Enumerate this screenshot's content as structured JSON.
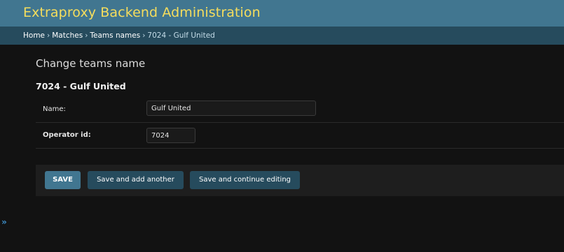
{
  "header": {
    "site_title": "Extraproxy Backend Administration"
  },
  "breadcrumbs": {
    "items": [
      "Home",
      "Matches",
      "Teams names",
      "7024 - Gulf United"
    ],
    "separator": "›"
  },
  "main": {
    "page_heading": "Change teams name",
    "object_title": "7024 - Gulf United",
    "fields": {
      "name": {
        "label": "Name:",
        "value": "Gulf United"
      },
      "operator_id": {
        "label": "Operator id:",
        "value": "7024"
      }
    }
  },
  "submit_row": {
    "save_label": "SAVE",
    "save_add_label": "Save and add another",
    "save_continue_label": "Save and continue editing"
  },
  "sidebar": {
    "toggle_icon": "double-chevron-right-icon",
    "toggle_glyph": "»"
  },
  "colors": {
    "header_bg": "#417690",
    "site_title": "#f5dd5d",
    "breadcrumbs_bg": "#264b5d",
    "button_primary": "#417690",
    "button_secondary": "#264b5d",
    "page_bg": "#121212"
  }
}
